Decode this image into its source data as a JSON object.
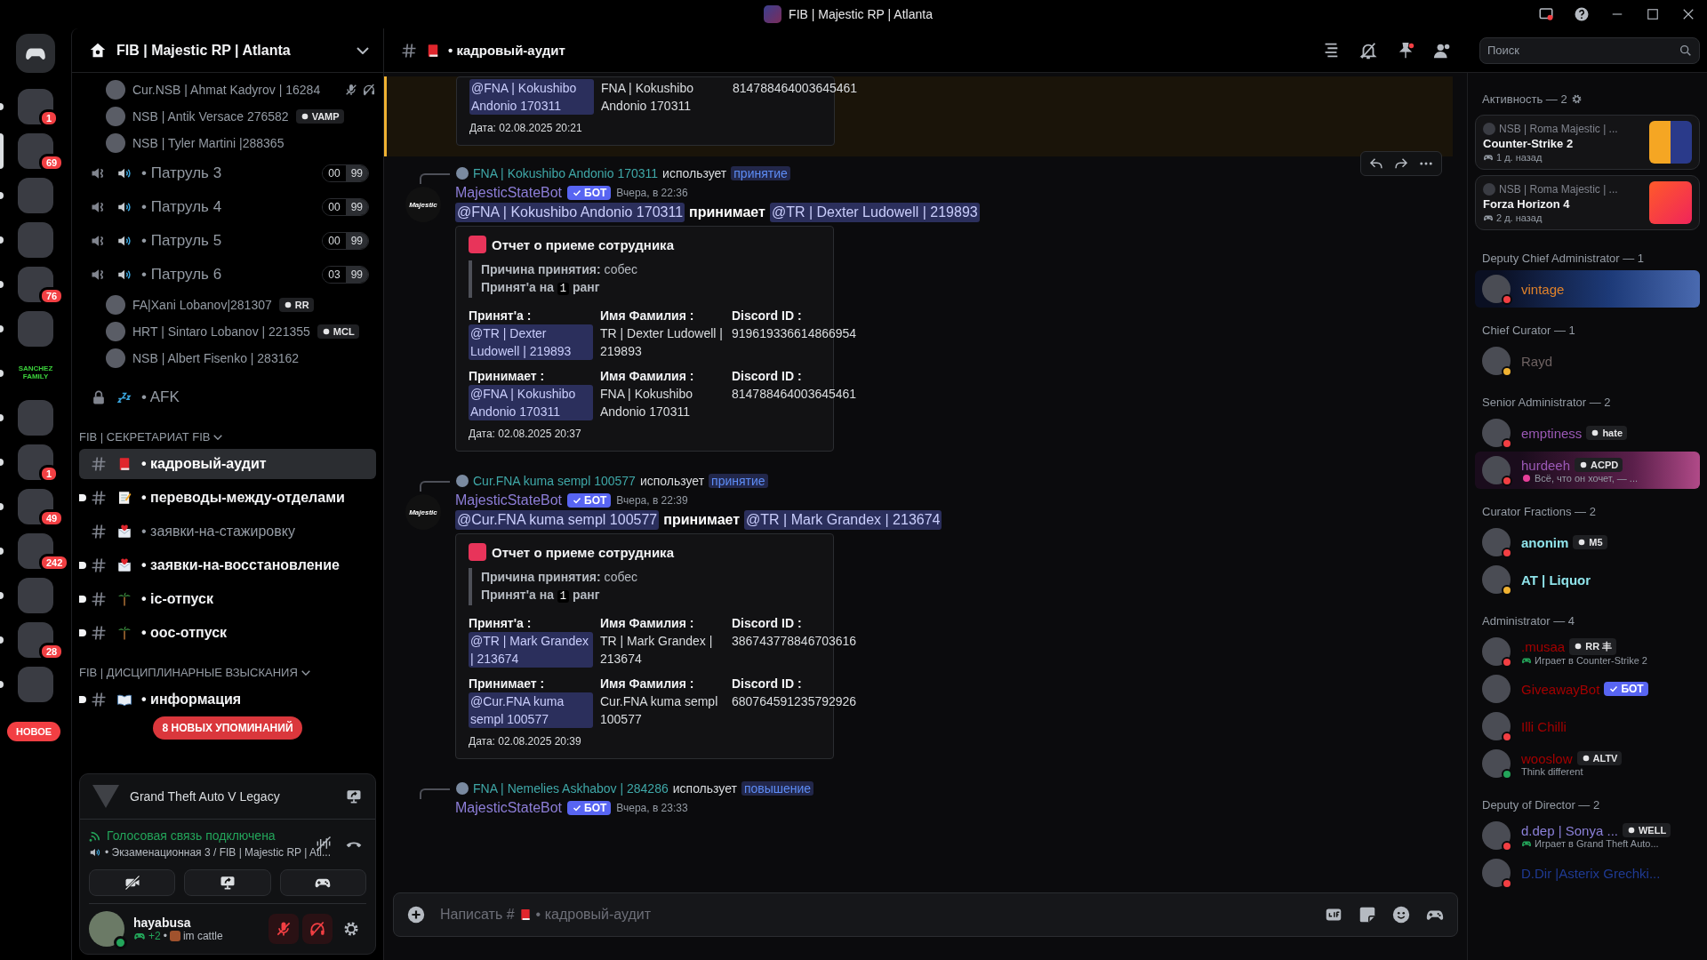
{
  "window": {
    "title": "FIB | Majestic RP | Atlanta"
  },
  "servers": [
    {
      "selected": false,
      "badge": "1"
    },
    {
      "selected": true,
      "badge": "69"
    },
    {
      "selected": false
    },
    {
      "selected": false
    },
    {
      "selected": false,
      "badge": "76"
    },
    {
      "selected": false
    },
    {
      "selected": false,
      "label": "SANCHEZ FAMILY"
    },
    {
      "selected": false
    },
    {
      "selected": false,
      "badge": "1"
    },
    {
      "selected": false,
      "badge": "49"
    },
    {
      "selected": false,
      "badge": "242"
    },
    {
      "selected": false
    },
    {
      "selected": false,
      "badge": "28"
    },
    {
      "selected": false
    }
  ],
  "new_pill": "НОВОЕ",
  "sidebar": {
    "server_name": "FIB | Majestic RP | Atlanta",
    "voice_top_users": [
      {
        "name": "Cur.NSB | Ahmat Kadyrov | 16284",
        "muted": true,
        "deafened": true
      },
      {
        "name": "NSB | Antik Versace 276582",
        "tag": "VAMP",
        "muted": false,
        "deafened": false
      },
      {
        "name": "NSB | Tyler Martini |288365",
        "muted": false,
        "deafened": false
      }
    ],
    "voice_channels": [
      {
        "name": "• Патруль 3",
        "count": "00",
        "limit": "99"
      },
      {
        "name": "• Патруль 4",
        "count": "00",
        "limit": "99"
      },
      {
        "name": "• Патруль 5",
        "count": "00",
        "limit": "99"
      },
      {
        "name": "• Патруль 6",
        "count": "03",
        "limit": "99",
        "users": [
          {
            "name": "FA|Xani Lobanov|281307",
            "tag": "RR",
            "muted": false,
            "deafened": false
          },
          {
            "name": "HRT | Sintaro Lobanov | 221355",
            "tag": "MCL",
            "muted": false,
            "deafened": false
          },
          {
            "name": "NSB | Albert Fisenko | 283162",
            "muted": false,
            "deafened": false
          }
        ]
      }
    ],
    "afk": {
      "name": "• AFK",
      "locked": true
    },
    "categories": [
      {
        "name": "FIB | СЕКРЕТАРИАТ FIB",
        "channels": [
          {
            "kind": "book",
            "name": "• кадровый-аудит",
            "selected": true,
            "unread": true
          },
          {
            "kind": "memo",
            "name": "• переводы-между-отделами",
            "selected": false,
            "unread": true
          },
          {
            "kind": "letter",
            "name": "• заявки-на-стажировку",
            "selected": false,
            "unread": false
          },
          {
            "kind": "letter",
            "name": "• заявки-на-восстановление",
            "selected": false,
            "unread": true
          },
          {
            "kind": "palm",
            "name": "• ic-отпуск",
            "selected": false,
            "unread": true
          },
          {
            "kind": "palm",
            "name": "• ooc-отпуск",
            "selected": false,
            "unread": true
          }
        ]
      },
      {
        "name": "FIB | ДИСЦИПЛИНАРНЫЕ ВЗЫСКАНИЯ",
        "channels": [
          {
            "kind": "openbook",
            "name": "• информация",
            "selected": false,
            "unread": true
          }
        ]
      }
    ],
    "mentions_pill": "8 НОВЫХ УПОМИНАНИЙ"
  },
  "activity_panel": {
    "game": "Grand Theft Auto V Legacy"
  },
  "voice_panel": {
    "status": "Голосовая связь подключена",
    "channel": "• Экзаменационная 3 / FIB | Majestic RP | Atl..."
  },
  "user_panel": {
    "name": "hayabusa",
    "extra": "+2",
    "separator": "•",
    "custom_status": "im cattle",
    "presence": {
      "kind": "online"
    },
    "muted": true,
    "deafened": true
  },
  "chat": {
    "channel": {
      "kind": "book",
      "name": "• кадровый-аудит"
    },
    "search": {
      "placeholder": "Поиск"
    },
    "messages": [
      {
        "kind": "embed_tail",
        "highlighted": true,
        "fields": [
          {
            "kind": "mention",
            "value": "@FNA | Kokushibo Andonio 170311"
          },
          {
            "kind": "text",
            "value": "FNA | Kokushibo Andonio 170311"
          },
          {
            "kind": "text",
            "value": "814788464003645461"
          }
        ],
        "date": "Дата: 02.08.2025 20:21"
      },
      {
        "kind": "bot_message",
        "highlighted": false,
        "avatar_text": "Majestic",
        "reply": {
          "user": "FNA | Kokushibo Andonio 170311",
          "verb": "использует",
          "command": "принятие"
        },
        "author": "MajesticStateBot",
        "badge": "БОТ",
        "time": "Вчера, в 22:36",
        "actions": [
          {
            "kind": "reply"
          },
          {
            "kind": "forward"
          },
          {
            "kind": "more"
          }
        ],
        "content": [
          {
            "kind": "mention",
            "text": "@FNA | Kokushibo Andonio 170311"
          },
          {
            "kind": "text",
            "text": "принимает"
          },
          {
            "kind": "mention",
            "text": "@TR | Dexter Ludowell | 219893"
          }
        ],
        "embed": {
          "title": "Отчет о приеме сотрудника",
          "reason_label": "Причина принятия:",
          "reason": "собес",
          "rank_before": "Принят'а на",
          "rank": "1",
          "rank_after": "ранг",
          "field_rows": [
            [
              {
                "label": "Принят'а :",
                "kind": "mention",
                "value": "@TR | Dexter Ludowell | 219893"
              },
              {
                "label": "Имя Фамилия :",
                "kind": "text",
                "value": "TR | Dexter Ludowell | 219893"
              },
              {
                "label": "Discord ID :",
                "kind": "text",
                "value": "919619336614866954"
              }
            ],
            [
              {
                "label": "Принимает :",
                "kind": "mention",
                "value": "@FNA | Kokushibo Andonio 170311"
              },
              {
                "label": "Имя Фамилия :",
                "kind": "text",
                "value": "FNA | Kokushibo Andonio 170311"
              },
              {
                "label": "Discord ID :",
                "kind": "text",
                "value": "814788464003645461"
              }
            ]
          ],
          "date": "Дата: 02.08.2025 20:37"
        }
      },
      {
        "kind": "bot_message",
        "highlighted": false,
        "avatar_text": "Majestic",
        "reply": {
          "user": "Cur.FNA  kuma sempl  100577",
          "verb": "использует",
          "command": "принятие"
        },
        "author": "MajesticStateBot",
        "badge": "БОТ",
        "time": "Вчера, в 22:39",
        "content": [
          {
            "kind": "mention",
            "text": "@Cur.FNA  kuma sempl  100577"
          },
          {
            "kind": "text",
            "text": "принимает"
          },
          {
            "kind": "mention",
            "text": "@TR | Mark Grandex | 213674"
          }
        ],
        "embed": {
          "title": "Отчет о приеме сотрудника",
          "reason_label": "Причина принятия:",
          "reason": "собес",
          "rank_before": "Принят'а на",
          "rank": "1",
          "rank_after": "ранг",
          "field_rows": [
            [
              {
                "label": "Принят'а :",
                "kind": "mention",
                "value": "@TR | Mark Grandex | 213674"
              },
              {
                "label": "Имя Фамилия :",
                "kind": "text",
                "value": "TR | Mark Grandex | 213674"
              },
              {
                "label": "Discord ID :",
                "kind": "text",
                "value": "386743778846703616"
              }
            ],
            [
              {
                "label": "Принимает :",
                "kind": "mention",
                "value": "@Cur.FNA kuma sempl 100577"
              },
              {
                "label": "Имя Фамилия :",
                "kind": "text",
                "value": "Cur.FNA kuma sempl 100577"
              },
              {
                "label": "Discord ID :",
                "kind": "text",
                "value": "680764591235792926"
              }
            ]
          ],
          "date": "Дата: 02.08.2025 20:39"
        }
      },
      {
        "kind": "bot_header",
        "highlighted": false,
        "reply": {
          "user": "FNA | Nemelies Askhabov | 284286",
          "verb": "использует",
          "command": "повышение"
        },
        "author": "MajesticStateBot",
        "badge": "БОТ",
        "time": "Вчера, в 23:33"
      }
    ],
    "composer": {
      "prefix": "Написать #",
      "kind": "book",
      "channel": "• кадровый-аудит"
    }
  },
  "members": {
    "activity_header": "Активность — 2",
    "activities": [
      {
        "user": "NSB | Roma Majestic | ...",
        "game": "Counter-Strike 2",
        "time": "1 д. назад",
        "kind": "shooter"
      },
      {
        "user": "NSB | Roma Majestic | ...",
        "game": "Forza Horizon 4",
        "time": "2 д. назад",
        "kind": "racing"
      }
    ],
    "groups": [
      {
        "title": "Deputy Chief Administrator — 1",
        "members": [
          {
            "name": "vintage",
            "color": "#e0822a",
            "presence": {
              "kind": "dnd"
            },
            "nameplate": {
              "kind": "space"
            }
          }
        ]
      },
      {
        "title": "Chief Curator — 1",
        "members": [
          {
            "name": "Rayd",
            "color": "#6e6262",
            "presence": {
              "kind": "idle"
            }
          }
        ]
      },
      {
        "title": "Senior Administrator — 2",
        "members": [
          {
            "name": "emptiness",
            "color": "#9b59b6",
            "presence": {
              "kind": "dnd"
            },
            "tag": "hate"
          },
          {
            "name": "hurdeeh",
            "color": "#9b59b6",
            "presence": {
              "kind": "dnd"
            },
            "tag": "ACPD",
            "nameplate": {
              "kind": "sakura"
            },
            "sub": {
              "kind": "emoji_status",
              "text": "Всё, что он хочет, — ..."
            }
          }
        ]
      },
      {
        "title": "Curator Fractions — 2",
        "members": [
          {
            "name": "anonim",
            "color": "#8fe3ea",
            "presence": {
              "kind": "dnd"
            },
            "tag": "M5",
            "bold": true
          },
          {
            "name": "AT | Liquor",
            "color": "#8fe3ea",
            "presence": {
              "kind": "idle"
            },
            "bold": true
          }
        ]
      },
      {
        "title": "Administrator — 4",
        "members": [
          {
            "name": ".musaa",
            "color": "#a30000",
            "presence": {
              "kind": "dnd"
            },
            "tag": "RR 丰",
            "sub": {
              "kind": "game",
              "text": "Играет в Counter-Strike 2"
            }
          },
          {
            "name": "GiveawayBot",
            "color": "#a30000",
            "bot": "БОТ"
          },
          {
            "name": "Illi Chilli",
            "color": "#a30000",
            "presence": {
              "kind": "dnd"
            }
          },
          {
            "name": "wooslow",
            "color": "#a30000",
            "presence": {
              "kind": "online"
            },
            "tag": "ALTV",
            "sub": {
              "kind": "status",
              "text": "Think different"
            }
          }
        ]
      },
      {
        "title": "Deputy of Director — 2",
        "members": [
          {
            "name": "d.dep | Sonya ...",
            "color": "#8b80d8",
            "presence": {
              "kind": "dnd"
            },
            "tag": "WELL",
            "sub": {
              "kind": "game",
              "text": "Играет в Grand Theft Auto..."
            }
          },
          {
            "name": "D.Dir |Asterix Grechki...",
            "color": "#1f3a93",
            "presence": {
              "kind": "dnd"
            }
          }
        ]
      }
    ]
  }
}
